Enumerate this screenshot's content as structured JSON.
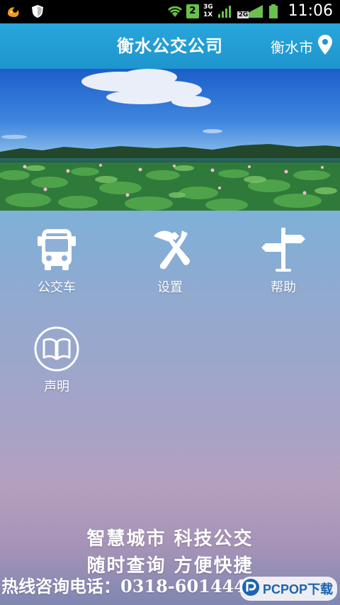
{
  "status_bar": {
    "sim_slot": "2",
    "network_3g": "3G",
    "network_1x": "1X",
    "network_2g": "2G",
    "time": "11:06",
    "icons": [
      "uc-browser-icon",
      "shield-icon",
      "wifi-icon",
      "signal-icon",
      "battery-icon"
    ]
  },
  "header": {
    "title": "衡水公交公司",
    "city": "衡水市",
    "city_icon": "location-pin-icon"
  },
  "menu": {
    "items": [
      {
        "label": "公交车",
        "icon": "bus-icon"
      },
      {
        "label": "设置",
        "icon": "tools-icon"
      },
      {
        "label": "帮助",
        "icon": "signpost-icon"
      },
      {
        "label": "声明",
        "icon": "book-icon"
      }
    ]
  },
  "footer": {
    "slogan_line1": "智慧城市  科技公交",
    "slogan_line2": "随时查询  方便快捷",
    "hotline": "热线咨询电话：0318-6014448"
  },
  "watermark": {
    "text": "PCPOP下载"
  },
  "colors": {
    "header_blue": "#1e95cd",
    "status_green": "#6bc04b"
  }
}
